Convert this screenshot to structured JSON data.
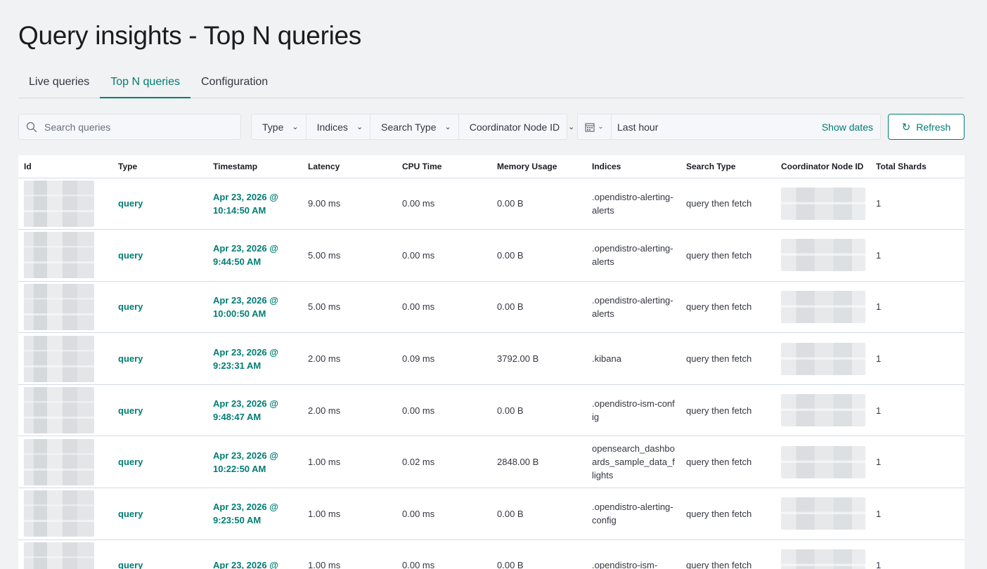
{
  "page_title": "Query insights - Top N queries",
  "tabs": [
    {
      "label": "Live queries",
      "active": false
    },
    {
      "label": "Top N queries",
      "active": true
    },
    {
      "label": "Configuration",
      "active": false
    }
  ],
  "search": {
    "placeholder": "Search queries",
    "icon": "search-icon"
  },
  "filters": [
    "Type",
    "Indices",
    "Search Type",
    "Coordinator Node ID"
  ],
  "date": {
    "icon": "calendar-icon",
    "label": "Last hour",
    "show_dates": "Show dates"
  },
  "refresh": {
    "label": "Refresh",
    "icon": "refresh-icon"
  },
  "colors": {
    "accent": "#017d73",
    "background": "#f1f2f3"
  },
  "table": {
    "columns": [
      "Id",
      "Type",
      "Timestamp",
      "Latency",
      "CPU Time",
      "Memory Usage",
      "Indices",
      "Search Type",
      "Coordinator Node ID",
      "Total Shards"
    ],
    "rows": [
      {
        "type": "query",
        "timestamp": "Apr 23, 2026 @ 10:14:50 AM",
        "latency": "9.00 ms",
        "cpu": "0.00 ms",
        "memory": "0.00 B",
        "indices": ".opendistro-alerting-alerts",
        "search_type": "query then fetch",
        "shards": "1"
      },
      {
        "type": "query",
        "timestamp": "Apr 23, 2026 @ 9:44:50 AM",
        "latency": "5.00 ms",
        "cpu": "0.00 ms",
        "memory": "0.00 B",
        "indices": ".opendistro-alerting-alerts",
        "search_type": "query then fetch",
        "shards": "1"
      },
      {
        "type": "query",
        "timestamp": "Apr 23, 2026 @ 10:00:50 AM",
        "latency": "5.00 ms",
        "cpu": "0.00 ms",
        "memory": "0.00 B",
        "indices": ".opendistro-alerting-alerts",
        "search_type": "query then fetch",
        "shards": "1"
      },
      {
        "type": "query",
        "timestamp": "Apr 23, 2026 @ 9:23:31 AM",
        "latency": "2.00 ms",
        "cpu": "0.09 ms",
        "memory": "3792.00 B",
        "indices": ".kibana",
        "search_type": "query then fetch",
        "shards": "1"
      },
      {
        "type": "query",
        "timestamp": "Apr 23, 2026 @ 9:48:47 AM",
        "latency": "2.00 ms",
        "cpu": "0.00 ms",
        "memory": "0.00 B",
        "indices": ".opendistro-ism-config",
        "search_type": "query then fetch",
        "shards": "1"
      },
      {
        "type": "query",
        "timestamp": "Apr 23, 2026 @ 10:22:50 AM",
        "latency": "1.00 ms",
        "cpu": "0.02 ms",
        "memory": "2848.00 B",
        "indices": "opensearch_dashboards_sample_data_flights",
        "search_type": "query then fetch",
        "shards": "1"
      },
      {
        "type": "query",
        "timestamp": "Apr 23, 2026 @ 9:23:50 AM",
        "latency": "1.00 ms",
        "cpu": "0.00 ms",
        "memory": "0.00 B",
        "indices": ".opendistro-alerting-config",
        "search_type": "query then fetch",
        "shards": "1"
      },
      {
        "type": "query",
        "timestamp": "Apr 23, 2026 @",
        "latency": "1.00 ms",
        "cpu": "0.00 ms",
        "memory": "0.00 B",
        "indices": ".opendistro-ism-",
        "search_type": "query then fetch",
        "shards": "1"
      }
    ]
  }
}
